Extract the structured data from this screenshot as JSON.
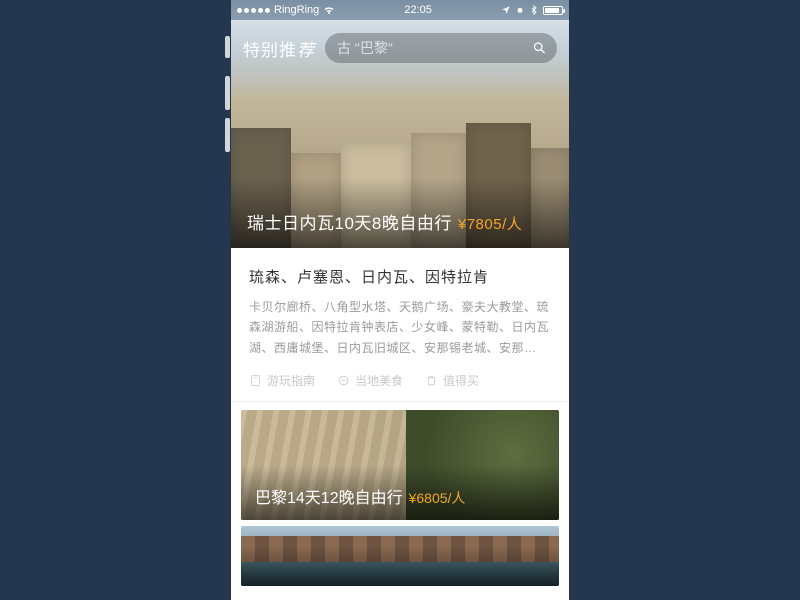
{
  "status": {
    "carrier": "RingRing",
    "time": "22:05"
  },
  "header": {
    "brand_prefix": "特别推",
    "brand_em": "荐",
    "search_placeholder": "古 \"巴黎\""
  },
  "hero": {
    "title": "瑞士日内瓦10天8晚自由行",
    "price": "¥7805/人"
  },
  "desc": {
    "title": "琉森、卢塞恩、日内瓦、因特拉肯",
    "body": "卡贝尔廊桥、八角型水塔、天鹅广场、豪夫大教堂、琉森湖游船、因特拉肯钟表店、少女峰、蒙特勒、日内瓦湖、西庸城堡、日内瓦旧城区、安那锡老城、安那…"
  },
  "tags": {
    "t1": "游玩指南",
    "t2": "当地美食",
    "t3": "值得买"
  },
  "card2": {
    "title": "巴黎14天12晚自由行",
    "price": "¥6805/人"
  }
}
